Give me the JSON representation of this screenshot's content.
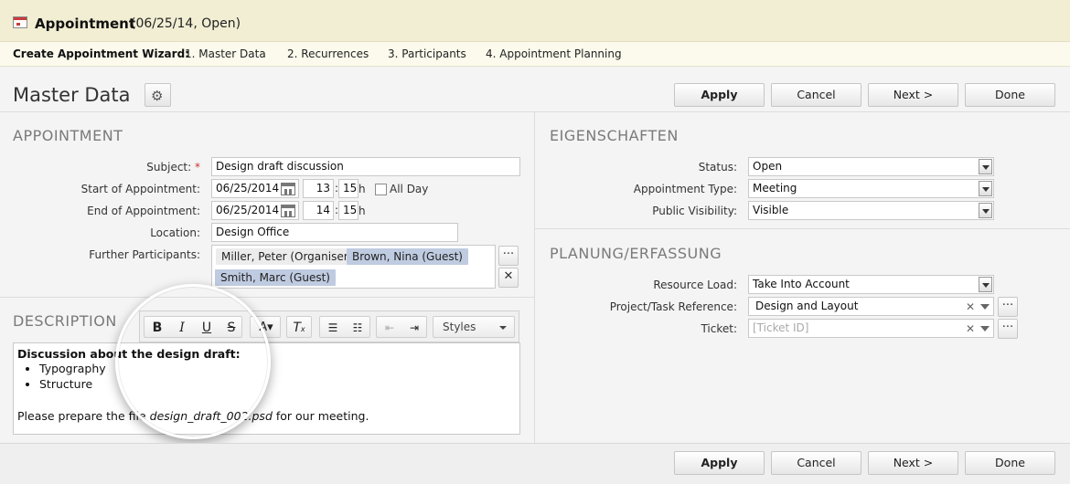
{
  "header": {
    "title": "Appointment",
    "subtitle": "(06/25/14, Open)"
  },
  "wizard": {
    "label": "Create Appointment Wizard:",
    "steps": [
      "1. Master Data",
      "2. Recurrences",
      "3. Participants",
      "4. Appointment Planning"
    ]
  },
  "toolbar": {
    "page_title": "Master Data",
    "settings_icon": "gear-icon"
  },
  "buttons": {
    "apply": "Apply",
    "cancel": "Cancel",
    "next": "Next >",
    "done": "Done"
  },
  "appointment": {
    "heading": "APPOINTMENT",
    "subject_label": "Subject:",
    "subject_value": "Design draft discussion",
    "start_label": "Start of Appointment:",
    "start_date": "06/25/2014",
    "start_hour": "13",
    "start_min": "15",
    "end_label": "End of Appointment:",
    "end_date": "06/25/2014",
    "end_hour": "14",
    "end_min": "15",
    "hour_unit": "h",
    "time_sep": ":",
    "allday_label": "All Day",
    "location_label": "Location:",
    "location_value": "Design Office",
    "participants_label": "Further Participants:",
    "participants": [
      "Miller, Peter (Organiser)",
      "Brown, Nina (Guest)",
      "Smith, Marc (Guest)"
    ]
  },
  "description": {
    "heading": "DESCRIPTION",
    "styles_label": "Styles",
    "bold_line": "Discussion about the design draft:",
    "bullets": [
      "Typography",
      "Structure"
    ],
    "text_before": "Please prepare the file ",
    "text_italic": "design_draft_002.psd",
    "text_after": " for our meeting."
  },
  "properties": {
    "heading": "EIGENSCHAFTEN",
    "status_label": "Status:",
    "status_value": "Open",
    "type_label": "Appointment Type:",
    "type_value": "Meeting",
    "visibility_label": "Public Visibility:",
    "visibility_value": "Visible"
  },
  "planning": {
    "heading": "PLANUNG/ERFASSUNG",
    "resource_label": "Resource Load:",
    "resource_value": "Take Into Account",
    "project_label": "Project/Task Reference:",
    "project_value": "Design and Layout",
    "ticket_label": "Ticket:",
    "ticket_placeholder": "[Ticket ID]"
  },
  "symbols": {
    "ellipsis": "···",
    "close": "✕",
    "clear": "✕"
  }
}
